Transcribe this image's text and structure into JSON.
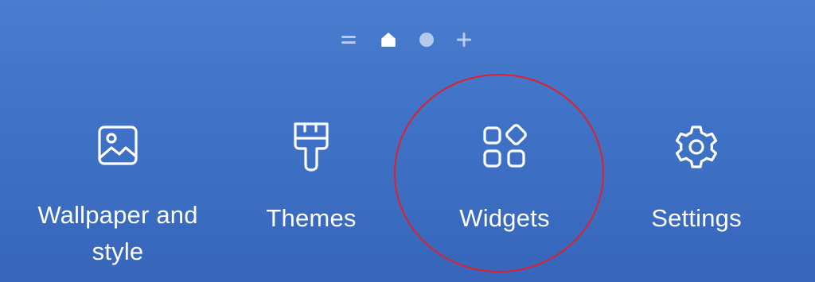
{
  "page_indicator": {
    "items": [
      {
        "icon": "menu-lines-icon"
      },
      {
        "icon": "home-icon",
        "active": true
      },
      {
        "icon": "dot-icon"
      },
      {
        "icon": "plus-icon"
      }
    ]
  },
  "actions": {
    "wallpaper": {
      "label": "Wallpaper and style",
      "icon": "image-icon"
    },
    "themes": {
      "label": "Themes",
      "icon": "paint-brush-icon"
    },
    "widgets": {
      "label": "Widgets",
      "icon": "widgets-grid-icon"
    },
    "settings": {
      "label": "Settings",
      "icon": "gear-icon"
    }
  },
  "colors": {
    "background": "#4177c9",
    "foreground": "#ffffff",
    "highlight_ring": "#e0202a"
  }
}
